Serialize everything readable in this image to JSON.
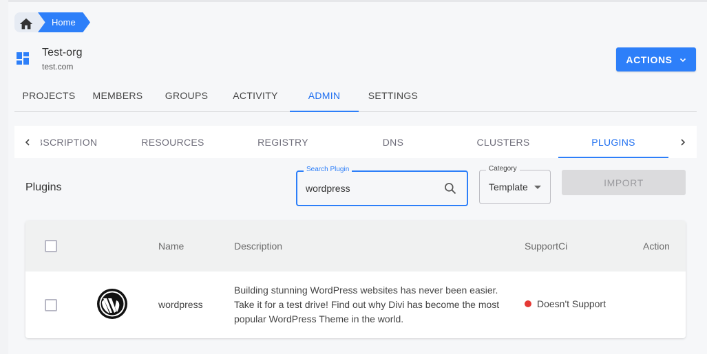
{
  "breadcrumb": {
    "home_icon": "home-icon",
    "current": "Home"
  },
  "org": {
    "icon": "dashboard-icon",
    "name": "Test-org",
    "domain": "test.com"
  },
  "actions_button": {
    "label": "ACTIONS",
    "icon": "chevron-down-icon"
  },
  "main_tabs": [
    {
      "label": "PROJECTS",
      "active": false
    },
    {
      "label": "MEMBERS",
      "active": false
    },
    {
      "label": "GROUPS",
      "active": false
    },
    {
      "label": "ACTIVITY",
      "active": false
    },
    {
      "label": "ADMIN",
      "active": true
    },
    {
      "label": "SETTINGS",
      "active": false
    }
  ],
  "sub_tabs": [
    {
      "label": "SUBSCRIPTION",
      "active": false
    },
    {
      "label": "RESOURCES",
      "active": false
    },
    {
      "label": "REGISTRY",
      "active": false
    },
    {
      "label": "DNS",
      "active": false
    },
    {
      "label": "CLUSTERS",
      "active": false
    },
    {
      "label": "PLUGINS",
      "active": true
    }
  ],
  "sub_tabs_scroll": {
    "left_icon": "chevron-left-icon",
    "right_icon": "chevron-right-icon"
  },
  "plugins": {
    "title": "Plugins",
    "search": {
      "label": "Search Plugin",
      "value": "wordpress",
      "icon": "search-icon"
    },
    "category": {
      "label": "Category",
      "value": "Template"
    },
    "import_label": "IMPORT",
    "table": {
      "columns": [
        "",
        "",
        "Name",
        "Description",
        "SupportCi",
        "Action"
      ],
      "rows": [
        {
          "icon": "wordpress-logo-icon",
          "name": "wordpress",
          "description": "Building stunning WordPress websites has never been easier. Take it for a test drive! Find out why Divi has become the most popular WordPress Theme in the world.",
          "support": "Doesn't Support",
          "support_color": "#e53935",
          "action": ""
        }
      ]
    }
  },
  "colors": {
    "accent": "#2d7ff9",
    "background": "#f6f7f9",
    "disabled_button": "#dbdbdd",
    "status_error": "#e53935"
  }
}
